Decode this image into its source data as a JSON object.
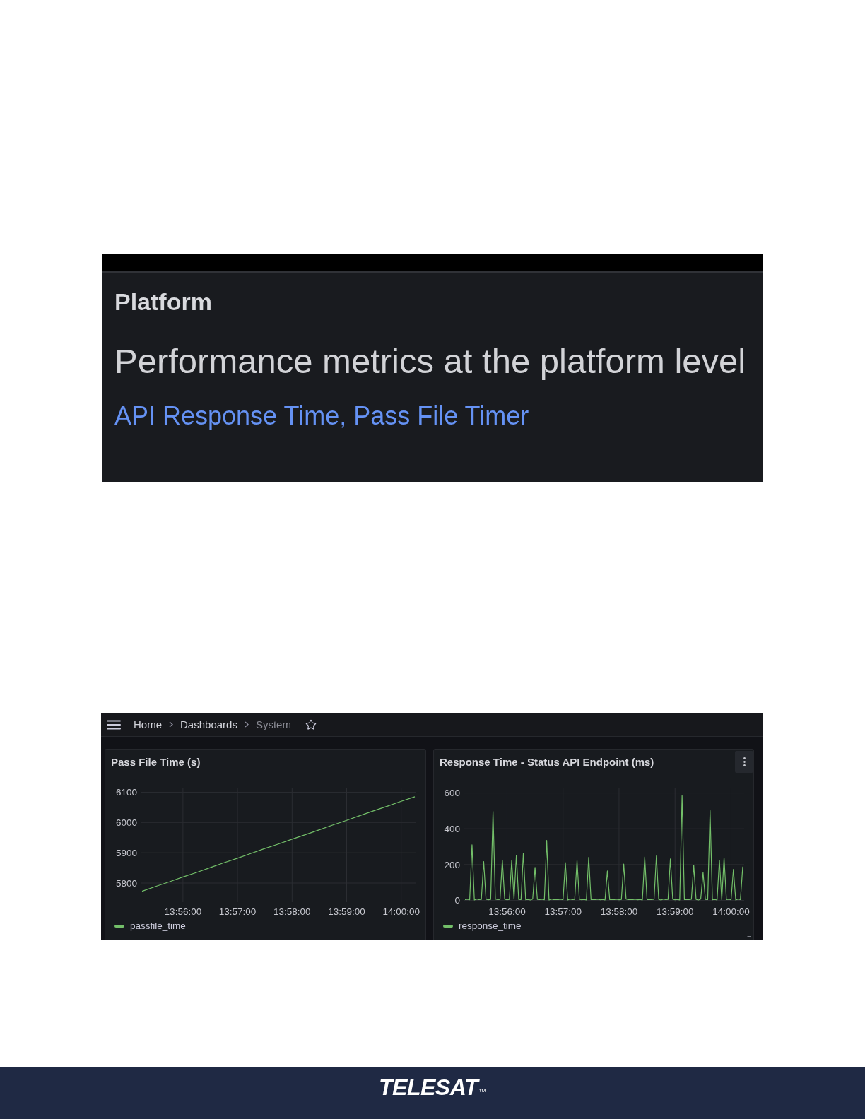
{
  "platform_panel": {
    "heading": "Platform",
    "title": "Performance metrics at the platform level",
    "link": "API Response Time, Pass File Timer"
  },
  "dashboard": {
    "breadcrumbs": [
      {
        "label": "Home",
        "current": false
      },
      {
        "label": "Dashboards",
        "current": false
      },
      {
        "label": "System",
        "current": true
      }
    ],
    "panels": [
      {
        "hovered": false,
        "chart_data": {
          "type": "line",
          "title": "Pass File Time (s)",
          "grid": true,
          "categories": [
            null,
            null,
            null,
            "13:56:00",
            null,
            null,
            null,
            "13:57:00",
            null,
            null,
            null,
            "13:58:00",
            null,
            null,
            null,
            "13:59:00",
            null,
            null,
            null,
            "14:00:00",
            null
          ],
          "series": [
            {
              "name": "passfile_time",
              "color": "#73bf69",
              "values": [
                5773,
                5789,
                5804,
                5820,
                5835,
                5851,
                5867,
                5882,
                5898,
                5914,
                5929,
                5945,
                5960,
                5976,
                5992,
                6007,
                6023,
                6039,
                6054,
                6070,
                6085
              ]
            }
          ],
          "ylim": [
            5737,
            6115
          ],
          "yticks": [
            5800,
            5900,
            6000,
            6100
          ]
        }
      },
      {
        "hovered": true,
        "chart_data": {
          "type": "line",
          "title": "Response Time - Status API Endpoint (ms)",
          "grid": true,
          "categories": [
            null,
            null,
            null,
            null,
            null,
            null,
            null,
            null,
            null,
            null,
            null,
            null,
            null,
            null,
            null,
            null,
            null,
            null,
            "13:56:00",
            null,
            null,
            null,
            null,
            null,
            null,
            null,
            null,
            null,
            null,
            null,
            null,
            null,
            null,
            null,
            null,
            null,
            null,
            null,
            null,
            null,
            null,
            null,
            "13:57:00",
            null,
            null,
            null,
            null,
            null,
            null,
            null,
            null,
            null,
            null,
            null,
            null,
            null,
            null,
            null,
            null,
            null,
            null,
            null,
            null,
            null,
            null,
            null,
            "13:58:00",
            null,
            null,
            null,
            null,
            null,
            null,
            null,
            null,
            null,
            null,
            null,
            null,
            null,
            null,
            null,
            null,
            null,
            null,
            null,
            null,
            null,
            null,
            null,
            "13:59:00",
            null,
            null,
            null,
            null,
            null,
            null,
            null,
            null,
            null,
            null,
            null,
            null,
            null,
            null,
            null,
            null,
            null,
            null,
            null,
            null,
            null,
            null,
            null,
            "14:00:00",
            null,
            null,
            null,
            null,
            null
          ],
          "series": [
            {
              "name": "response_time",
              "color": "#73bf69",
              "values": [
                4,
                6,
                3,
                311,
                2,
                7,
                4,
                5,
                217,
                6,
                3,
                5,
                497,
                7,
                4,
                5,
                226,
                6,
                3,
                5,
                222,
                7,
                252,
                5,
                4,
                264,
                3,
                5,
                2,
                7,
                184,
                5,
                4,
                6,
                3,
                335,
                2,
                7,
                4,
                5,
                4,
                6,
                3,
                211,
                2,
                7,
                4,
                5,
                222,
                6,
                3,
                5,
                2,
                240,
                4,
                5,
                4,
                6,
                3,
                5,
                2,
                164,
                4,
                5,
                4,
                6,
                3,
                5,
                203,
                7,
                4,
                5,
                4,
                6,
                3,
                5,
                2,
                242,
                4,
                5,
                4,
                6,
                248,
                5,
                2,
                7,
                4,
                5,
                232,
                6,
                3,
                5,
                2,
                585,
                4,
                5,
                4,
                6,
                197,
                5,
                2,
                7,
                156,
                5,
                4,
                502,
                3,
                5,
                2,
                225,
                4,
                238,
                4,
                6,
                3,
                173,
                2,
                7,
                4,
                188
              ]
            }
          ],
          "ylim": [
            -10,
            630
          ],
          "yticks": [
            0,
            200,
            400,
            600
          ]
        }
      }
    ]
  },
  "footer": {
    "logo": "TELESAT",
    "trademark": "™"
  }
}
